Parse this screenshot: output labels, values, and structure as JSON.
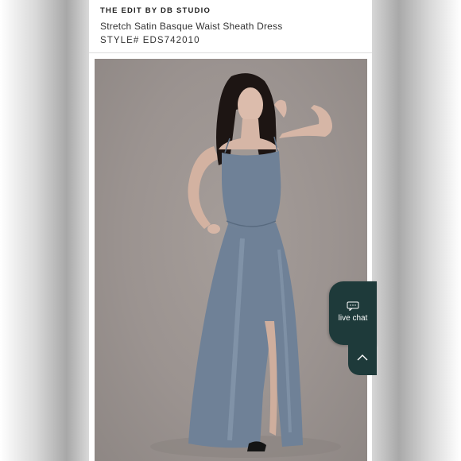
{
  "product": {
    "brand": "THE EDIT BY DB STUDIO",
    "name": "Stretch Satin Basque Waist Sheath Dress",
    "style_number": "STYLE# EDS742010"
  },
  "photo": {
    "alt": "Model in slate blue satin sheath dress"
  },
  "chat": {
    "label": "live chat",
    "icon": "chat-bubble-icon"
  },
  "scroll_top": {
    "icon": "chevron-up-icon"
  },
  "colors": {
    "accent": "#1e3a3a",
    "dress": "#6f8197",
    "backdrop": "#9b9390"
  }
}
